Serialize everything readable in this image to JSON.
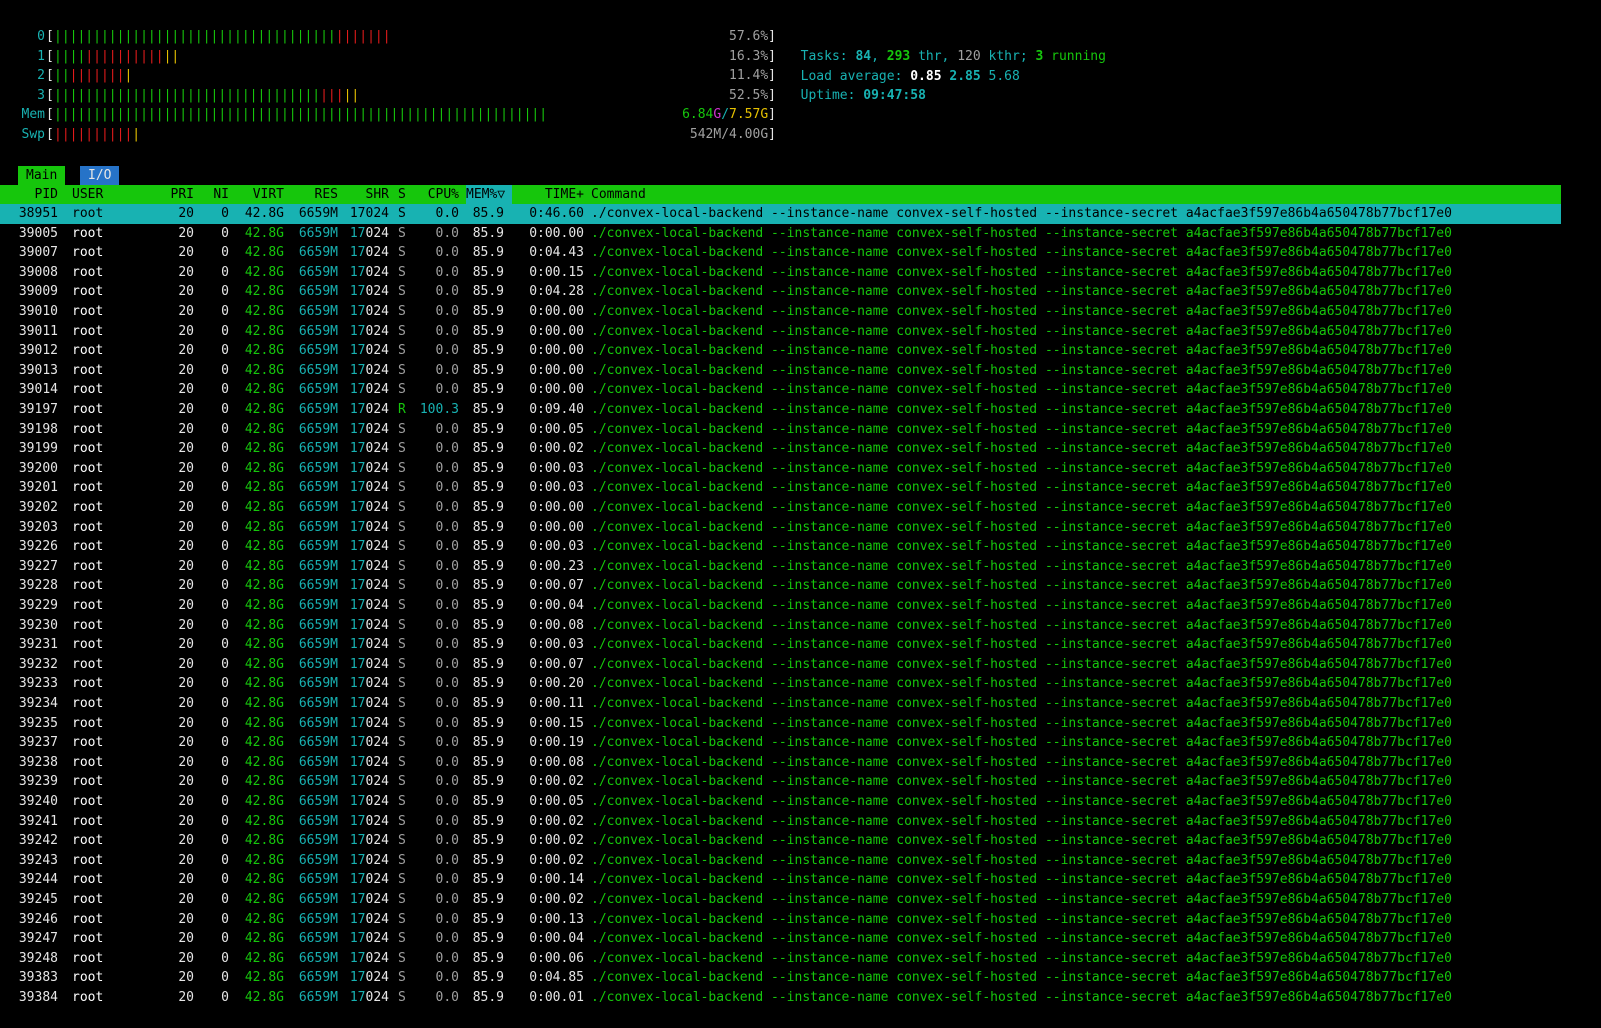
{
  "meters": {
    "cpu": [
      {
        "label": "0",
        "percent": "57.6%",
        "green": 36,
        "red": 7,
        "yellow": 0
      },
      {
        "label": "1",
        "percent": "16.3%",
        "green": 4,
        "red": 10,
        "yellow": 2
      },
      {
        "label": "2",
        "percent": "11.4%",
        "green": 2,
        "red": 7,
        "yellow": 1
      },
      {
        "label": "3",
        "percent": "52.5%",
        "green": 34,
        "red": 3,
        "yellow": 2
      }
    ],
    "mem": {
      "label": "Mem",
      "used": "6.84",
      "used_unit": "G",
      "sep": "/",
      "total": "7.57G",
      "green": 63
    },
    "swp": {
      "label": "Swp",
      "value": "542M/4.00G",
      "red": 10,
      "yellow": 1
    }
  },
  "summary": {
    "tasks_label": "Tasks:",
    "tasks": "84",
    "thr": "293",
    "thr_label": "thr,",
    "kthr": "120",
    "kthr_label": "kthr;",
    "running": "3",
    "running_label": "running",
    "load_label": "Load average:",
    "load1": "0.85",
    "load5": "2.85",
    "load15": "5.68",
    "uptime_label": "Uptime:",
    "uptime": "09:47:58"
  },
  "tabs": [
    {
      "label": "Main",
      "active": true
    },
    {
      "label": "I/O",
      "active": false
    }
  ],
  "columns": [
    "PID",
    "USER",
    "PRI",
    "NI",
    "VIRT",
    "RES",
    "SHR",
    "S",
    "CPU%",
    "MEM%▽",
    "TIME+",
    "Command"
  ],
  "command": "./convex-local-backend --instance-name convex-self-hosted --instance-secret a4acfae3f597e86b4a650478b77bcf17e0",
  "processes": [
    {
      "pid": "38951",
      "user": "root",
      "pri": "20",
      "ni": "0",
      "virt": "42.8G",
      "res": "6659M",
      "shr": "17024",
      "s": "S",
      "cpu": "0.0",
      "mem": "85.9",
      "time": "0:46.60",
      "selected": true
    },
    {
      "pid": "39005",
      "user": "root",
      "pri": "20",
      "ni": "0",
      "virt": "42.8G",
      "res": "6659M",
      "shr": "17024",
      "s": "S",
      "cpu": "0.0",
      "mem": "85.9",
      "time": "0:00.00"
    },
    {
      "pid": "39007",
      "user": "root",
      "pri": "20",
      "ni": "0",
      "virt": "42.8G",
      "res": "6659M",
      "shr": "17024",
      "s": "S",
      "cpu": "0.0",
      "mem": "85.9",
      "time": "0:04.43"
    },
    {
      "pid": "39008",
      "user": "root",
      "pri": "20",
      "ni": "0",
      "virt": "42.8G",
      "res": "6659M",
      "shr": "17024",
      "s": "S",
      "cpu": "0.0",
      "mem": "85.9",
      "time": "0:00.15"
    },
    {
      "pid": "39009",
      "user": "root",
      "pri": "20",
      "ni": "0",
      "virt": "42.8G",
      "res": "6659M",
      "shr": "17024",
      "s": "S",
      "cpu": "0.0",
      "mem": "85.9",
      "time": "0:04.28"
    },
    {
      "pid": "39010",
      "user": "root",
      "pri": "20",
      "ni": "0",
      "virt": "42.8G",
      "res": "6659M",
      "shr": "17024",
      "s": "S",
      "cpu": "0.0",
      "mem": "85.9",
      "time": "0:00.00"
    },
    {
      "pid": "39011",
      "user": "root",
      "pri": "20",
      "ni": "0",
      "virt": "42.8G",
      "res": "6659M",
      "shr": "17024",
      "s": "S",
      "cpu": "0.0",
      "mem": "85.9",
      "time": "0:00.00"
    },
    {
      "pid": "39012",
      "user": "root",
      "pri": "20",
      "ni": "0",
      "virt": "42.8G",
      "res": "6659M",
      "shr": "17024",
      "s": "S",
      "cpu": "0.0",
      "mem": "85.9",
      "time": "0:00.00"
    },
    {
      "pid": "39013",
      "user": "root",
      "pri": "20",
      "ni": "0",
      "virt": "42.8G",
      "res": "6659M",
      "shr": "17024",
      "s": "S",
      "cpu": "0.0",
      "mem": "85.9",
      "time": "0:00.00"
    },
    {
      "pid": "39014",
      "user": "root",
      "pri": "20",
      "ni": "0",
      "virt": "42.8G",
      "res": "6659M",
      "shr": "17024",
      "s": "S",
      "cpu": "0.0",
      "mem": "85.9",
      "time": "0:00.00"
    },
    {
      "pid": "39197",
      "user": "root",
      "pri": "20",
      "ni": "0",
      "virt": "42.8G",
      "res": "6659M",
      "shr": "17024",
      "s": "R",
      "cpu": "100.3",
      "mem": "85.9",
      "time": "0:09.40"
    },
    {
      "pid": "39198",
      "user": "root",
      "pri": "20",
      "ni": "0",
      "virt": "42.8G",
      "res": "6659M",
      "shr": "17024",
      "s": "S",
      "cpu": "0.0",
      "mem": "85.9",
      "time": "0:00.05"
    },
    {
      "pid": "39199",
      "user": "root",
      "pri": "20",
      "ni": "0",
      "virt": "42.8G",
      "res": "6659M",
      "shr": "17024",
      "s": "S",
      "cpu": "0.0",
      "mem": "85.9",
      "time": "0:00.02"
    },
    {
      "pid": "39200",
      "user": "root",
      "pri": "20",
      "ni": "0",
      "virt": "42.8G",
      "res": "6659M",
      "shr": "17024",
      "s": "S",
      "cpu": "0.0",
      "mem": "85.9",
      "time": "0:00.03"
    },
    {
      "pid": "39201",
      "user": "root",
      "pri": "20",
      "ni": "0",
      "virt": "42.8G",
      "res": "6659M",
      "shr": "17024",
      "s": "S",
      "cpu": "0.0",
      "mem": "85.9",
      "time": "0:00.03"
    },
    {
      "pid": "39202",
      "user": "root",
      "pri": "20",
      "ni": "0",
      "virt": "42.8G",
      "res": "6659M",
      "shr": "17024",
      "s": "S",
      "cpu": "0.0",
      "mem": "85.9",
      "time": "0:00.00"
    },
    {
      "pid": "39203",
      "user": "root",
      "pri": "20",
      "ni": "0",
      "virt": "42.8G",
      "res": "6659M",
      "shr": "17024",
      "s": "S",
      "cpu": "0.0",
      "mem": "85.9",
      "time": "0:00.00"
    },
    {
      "pid": "39226",
      "user": "root",
      "pri": "20",
      "ni": "0",
      "virt": "42.8G",
      "res": "6659M",
      "shr": "17024",
      "s": "S",
      "cpu": "0.0",
      "mem": "85.9",
      "time": "0:00.03"
    },
    {
      "pid": "39227",
      "user": "root",
      "pri": "20",
      "ni": "0",
      "virt": "42.8G",
      "res": "6659M",
      "shr": "17024",
      "s": "S",
      "cpu": "0.0",
      "mem": "85.9",
      "time": "0:00.23"
    },
    {
      "pid": "39228",
      "user": "root",
      "pri": "20",
      "ni": "0",
      "virt": "42.8G",
      "res": "6659M",
      "shr": "17024",
      "s": "S",
      "cpu": "0.0",
      "mem": "85.9",
      "time": "0:00.07"
    },
    {
      "pid": "39229",
      "user": "root",
      "pri": "20",
      "ni": "0",
      "virt": "42.8G",
      "res": "6659M",
      "shr": "17024",
      "s": "S",
      "cpu": "0.0",
      "mem": "85.9",
      "time": "0:00.04"
    },
    {
      "pid": "39230",
      "user": "root",
      "pri": "20",
      "ni": "0",
      "virt": "42.8G",
      "res": "6659M",
      "shr": "17024",
      "s": "S",
      "cpu": "0.0",
      "mem": "85.9",
      "time": "0:00.08"
    },
    {
      "pid": "39231",
      "user": "root",
      "pri": "20",
      "ni": "0",
      "virt": "42.8G",
      "res": "6659M",
      "shr": "17024",
      "s": "S",
      "cpu": "0.0",
      "mem": "85.9",
      "time": "0:00.03"
    },
    {
      "pid": "39232",
      "user": "root",
      "pri": "20",
      "ni": "0",
      "virt": "42.8G",
      "res": "6659M",
      "shr": "17024",
      "s": "S",
      "cpu": "0.0",
      "mem": "85.9",
      "time": "0:00.07"
    },
    {
      "pid": "39233",
      "user": "root",
      "pri": "20",
      "ni": "0",
      "virt": "42.8G",
      "res": "6659M",
      "shr": "17024",
      "s": "S",
      "cpu": "0.0",
      "mem": "85.9",
      "time": "0:00.20"
    },
    {
      "pid": "39234",
      "user": "root",
      "pri": "20",
      "ni": "0",
      "virt": "42.8G",
      "res": "6659M",
      "shr": "17024",
      "s": "S",
      "cpu": "0.0",
      "mem": "85.9",
      "time": "0:00.11"
    },
    {
      "pid": "39235",
      "user": "root",
      "pri": "20",
      "ni": "0",
      "virt": "42.8G",
      "res": "6659M",
      "shr": "17024",
      "s": "S",
      "cpu": "0.0",
      "mem": "85.9",
      "time": "0:00.15"
    },
    {
      "pid": "39237",
      "user": "root",
      "pri": "20",
      "ni": "0",
      "virt": "42.8G",
      "res": "6659M",
      "shr": "17024",
      "s": "S",
      "cpu": "0.0",
      "mem": "85.9",
      "time": "0:00.19"
    },
    {
      "pid": "39238",
      "user": "root",
      "pri": "20",
      "ni": "0",
      "virt": "42.8G",
      "res": "6659M",
      "shr": "17024",
      "s": "S",
      "cpu": "0.0",
      "mem": "85.9",
      "time": "0:00.08"
    },
    {
      "pid": "39239",
      "user": "root",
      "pri": "20",
      "ni": "0",
      "virt": "42.8G",
      "res": "6659M",
      "shr": "17024",
      "s": "S",
      "cpu": "0.0",
      "mem": "85.9",
      "time": "0:00.02"
    },
    {
      "pid": "39240",
      "user": "root",
      "pri": "20",
      "ni": "0",
      "virt": "42.8G",
      "res": "6659M",
      "shr": "17024",
      "s": "S",
      "cpu": "0.0",
      "mem": "85.9",
      "time": "0:00.05"
    },
    {
      "pid": "39241",
      "user": "root",
      "pri": "20",
      "ni": "0",
      "virt": "42.8G",
      "res": "6659M",
      "shr": "17024",
      "s": "S",
      "cpu": "0.0",
      "mem": "85.9",
      "time": "0:00.02"
    },
    {
      "pid": "39242",
      "user": "root",
      "pri": "20",
      "ni": "0",
      "virt": "42.8G",
      "res": "6659M",
      "shr": "17024",
      "s": "S",
      "cpu": "0.0",
      "mem": "85.9",
      "time": "0:00.02"
    },
    {
      "pid": "39243",
      "user": "root",
      "pri": "20",
      "ni": "0",
      "virt": "42.8G",
      "res": "6659M",
      "shr": "17024",
      "s": "S",
      "cpu": "0.0",
      "mem": "85.9",
      "time": "0:00.02"
    },
    {
      "pid": "39244",
      "user": "root",
      "pri": "20",
      "ni": "0",
      "virt": "42.8G",
      "res": "6659M",
      "shr": "17024",
      "s": "S",
      "cpu": "0.0",
      "mem": "85.9",
      "time": "0:00.14"
    },
    {
      "pid": "39245",
      "user": "root",
      "pri": "20",
      "ni": "0",
      "virt": "42.8G",
      "res": "6659M",
      "shr": "17024",
      "s": "S",
      "cpu": "0.0",
      "mem": "85.9",
      "time": "0:00.02"
    },
    {
      "pid": "39246",
      "user": "root",
      "pri": "20",
      "ni": "0",
      "virt": "42.8G",
      "res": "6659M",
      "shr": "17024",
      "s": "S",
      "cpu": "0.0",
      "mem": "85.9",
      "time": "0:00.13"
    },
    {
      "pid": "39247",
      "user": "root",
      "pri": "20",
      "ni": "0",
      "virt": "42.8G",
      "res": "6659M",
      "shr": "17024",
      "s": "S",
      "cpu": "0.0",
      "mem": "85.9",
      "time": "0:00.04"
    },
    {
      "pid": "39248",
      "user": "root",
      "pri": "20",
      "ni": "0",
      "virt": "42.8G",
      "res": "6659M",
      "shr": "17024",
      "s": "S",
      "cpu": "0.0",
      "mem": "85.9",
      "time": "0:00.06"
    },
    {
      "pid": "39383",
      "user": "root",
      "pri": "20",
      "ni": "0",
      "virt": "42.8G",
      "res": "6659M",
      "shr": "17024",
      "s": "S",
      "cpu": "0.0",
      "mem": "85.9",
      "time": "0:04.85"
    },
    {
      "pid": "39384",
      "user": "root",
      "pri": "20",
      "ni": "0",
      "virt": "42.8G",
      "res": "6659M",
      "shr": "17024",
      "s": "S",
      "cpu": "0.0",
      "mem": "85.9",
      "time": "0:00.01"
    }
  ],
  "colors": {
    "green": "#16c60c",
    "cyan": "#18b2b2",
    "red": "#e21b1b",
    "yellow": "#e5c100",
    "magenta": "#d233d2",
    "tab_io": "#2673c8"
  }
}
